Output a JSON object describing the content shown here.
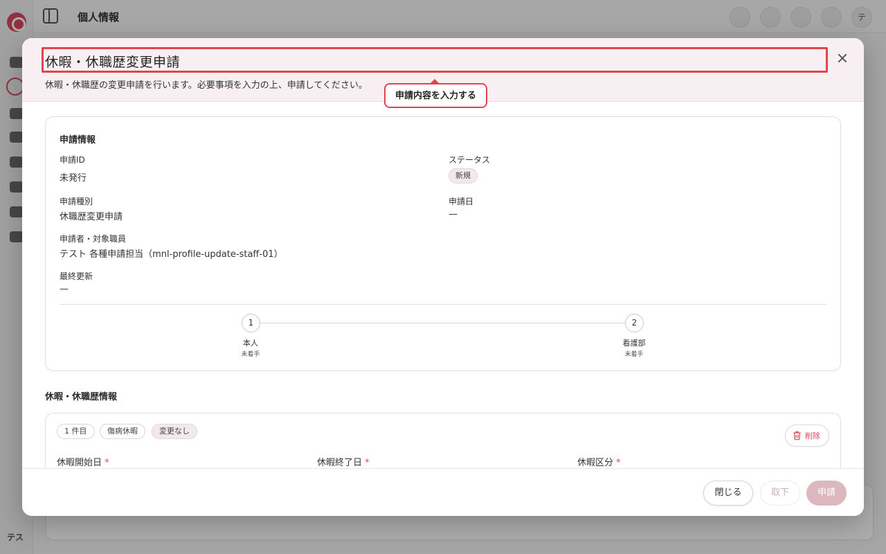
{
  "background": {
    "page_title": "個人情報",
    "user_initials": "テス",
    "avatar": "テ"
  },
  "modal": {
    "title": "休暇・休職歴変更申請",
    "description": "休暇・休職歴の変更申請を行います。必要事項を入力の上、申請してください。",
    "tooltip": "申請内容を入力する",
    "info": {
      "title": "申請情報",
      "id_label": "申請ID",
      "id_value": "未発行",
      "status_label": "ステータス",
      "status_value": "新規",
      "type_label": "申請種別",
      "type_value": "休職歴変更申請",
      "date_label": "申請日",
      "date_value": "—",
      "applicant_label": "申請者・対象職員",
      "applicant_value": "テスト 各種申請担当（mnl-profile-update-staff-01）",
      "updated_label": "最終更新",
      "updated_value": "—"
    },
    "steps": [
      {
        "number": "1",
        "name": "本人",
        "status": "未着手"
      },
      {
        "number": "2",
        "name": "看護部",
        "status": "未着手"
      }
    ],
    "leave_section": {
      "title": "休暇・休職歴情報",
      "chips": [
        "1 件目",
        "傷病休暇",
        "変更なし"
      ],
      "delete_label": "削除",
      "fields": [
        "休暇開始日",
        "休暇終了日",
        "休暇区分"
      ],
      "required_mark": "*"
    },
    "footer": {
      "close_label": "閉じる",
      "withdraw_label": "取下",
      "submit_label": "申請"
    }
  },
  "colors": {
    "accent": "#e0454f",
    "brand": "#d9485f",
    "submit_disabled": "#dcb7bf"
  }
}
